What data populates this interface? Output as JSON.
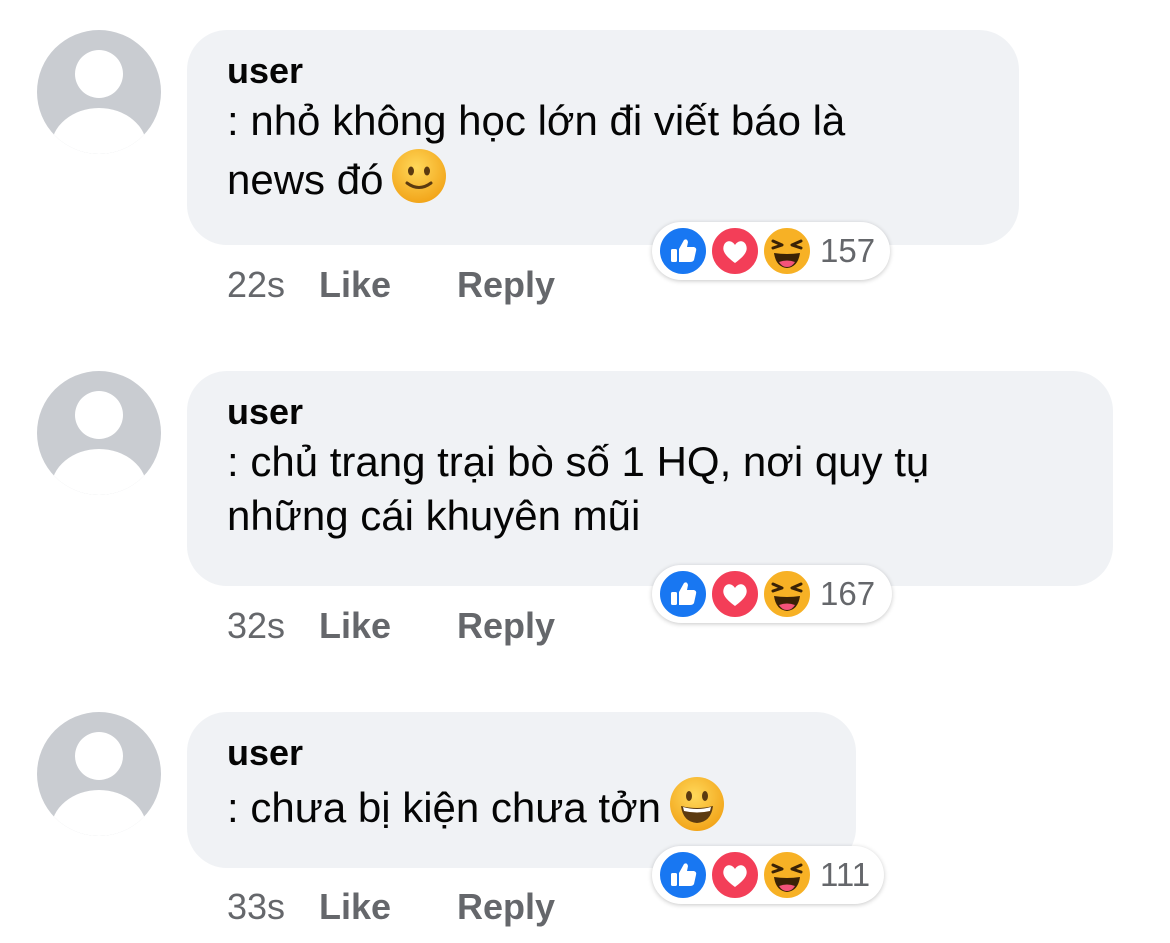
{
  "comments": [
    {
      "author": "user",
      "text_lines": [
        ": nhỏ không học lớn đi viết báo là",
        "news đó"
      ],
      "emoji": "slightly-smiling-face",
      "time": "22s",
      "like_label": "Like",
      "reply_label": "Reply",
      "reactions": [
        "like",
        "love",
        "haha"
      ],
      "reaction_count": "157"
    },
    {
      "author": "user",
      "text_lines": [
        ": chủ trang trại bò số 1 HQ, nơi quy tụ",
        "những cái khuyên mũi"
      ],
      "emoji": "",
      "time": "32s",
      "like_label": "Like",
      "reply_label": "Reply",
      "reactions": [
        "like",
        "love",
        "haha"
      ],
      "reaction_count": "167"
    },
    {
      "author": "user",
      "text_lines": [
        ": chưa bị kiện chưa tởn"
      ],
      "emoji": "grinning-face",
      "time": "33s",
      "like_label": "Like",
      "reply_label": "Reply",
      "reactions": [
        "like",
        "love",
        "haha"
      ],
      "reaction_count": "111"
    }
  ],
  "colors": {
    "bubble": "#f0f2f5",
    "meta_text": "#65676b",
    "like_blue": "#1877f2",
    "love_red": "#f33e58",
    "emoji_yellow": "#f7b125"
  }
}
